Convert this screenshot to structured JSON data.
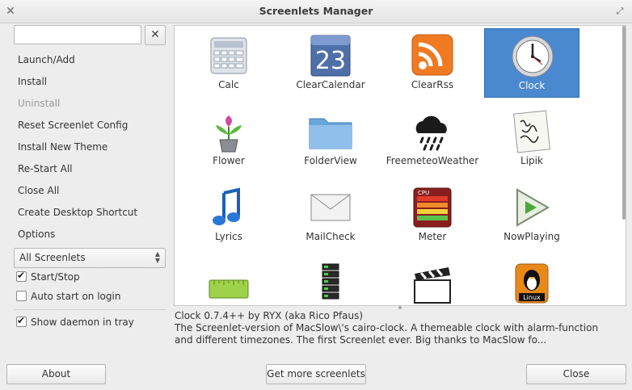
{
  "window": {
    "title": "Screenlets Manager"
  },
  "search": {
    "value": "",
    "placeholder": ""
  },
  "actions": [
    {
      "label": "Launch/Add",
      "enabled": true
    },
    {
      "label": "Install",
      "enabled": true
    },
    {
      "label": "Uninstall",
      "enabled": false
    },
    {
      "label": "Reset Screenlet Config",
      "enabled": true
    },
    {
      "label": "Install New Theme",
      "enabled": true
    },
    {
      "label": "Re-Start All",
      "enabled": true
    },
    {
      "label": "Close All",
      "enabled": true
    },
    {
      "label": "Create Desktop Shortcut",
      "enabled": true
    },
    {
      "label": "Options",
      "enabled": true
    }
  ],
  "filter": {
    "selected": "All Screenlets"
  },
  "checkboxes": {
    "start_stop": {
      "label": "Start/Stop",
      "checked": true
    },
    "auto_start": {
      "label": "Auto start on login",
      "checked": false
    },
    "show_daemon": {
      "label": "Show daemon in tray",
      "checked": true
    }
  },
  "screenlets": [
    {
      "name": "Calc",
      "icon": "calculator-icon"
    },
    {
      "name": "ClearCalendar",
      "icon": "calendar-icon",
      "icon_text": "23"
    },
    {
      "name": "ClearRss",
      "icon": "rss-icon"
    },
    {
      "name": "Clock",
      "icon": "clock-icon",
      "selected": true
    },
    {
      "name": "Flower",
      "icon": "flower-icon"
    },
    {
      "name": "FolderView",
      "icon": "folder-icon"
    },
    {
      "name": "FreemeteoWeather",
      "icon": "weather-icon"
    },
    {
      "name": "Lipik",
      "icon": "notepad-icon"
    },
    {
      "name": "Lyrics",
      "icon": "music-note-icon"
    },
    {
      "name": "MailCheck",
      "icon": "envelope-icon"
    },
    {
      "name": "Meter",
      "icon": "meter-icon",
      "icon_text": "CPU"
    },
    {
      "name": "NowPlaying",
      "icon": "play-icon"
    },
    {
      "name": "",
      "icon": "ruler-icon"
    },
    {
      "name": "",
      "icon": "server-stack-icon"
    },
    {
      "name": "",
      "icon": "clapperboard-icon"
    },
    {
      "name": "",
      "icon": "linux-tux-icon",
      "icon_text": "Linux"
    }
  ],
  "description": {
    "line1": "Clock 0.7.4++ by RYX (aka Rico Pfaus)",
    "line2": "The Screenlet-version of MacSlow\\'s cairo-clock. A themeable clock with alarm-function",
    "line3": "and different timezones. The first Screenlet ever. Big thanks to MacSlow fo..."
  },
  "buttons": {
    "about": "About",
    "get_more": "Get more screenlets",
    "close": "Close"
  },
  "colors": {
    "selection": "#4a88d0",
    "window_bg": "#ededed"
  }
}
